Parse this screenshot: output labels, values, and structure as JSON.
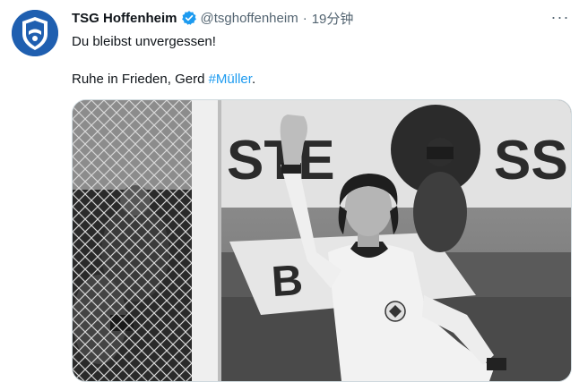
{
  "tweet": {
    "author_name": "TSG Hoffenheim",
    "handle": "@tsghoffenheim",
    "separator": "·",
    "time": "19分钟",
    "more_label": "···",
    "text_line1": "Du bleibst unvergessen!",
    "text_line2_prefix": "Ruhe in Frieden, Gerd ",
    "hashtag": "#Müller",
    "text_line2_suffix": ".",
    "verified_color": "#1d9bf0",
    "hashtag_color": "#1d9bf0"
  },
  "media": {
    "icon": "black-and-white-photo",
    "banner_left_text": "STE",
    "banner_right_text": "SS",
    "board_text": "B"
  }
}
